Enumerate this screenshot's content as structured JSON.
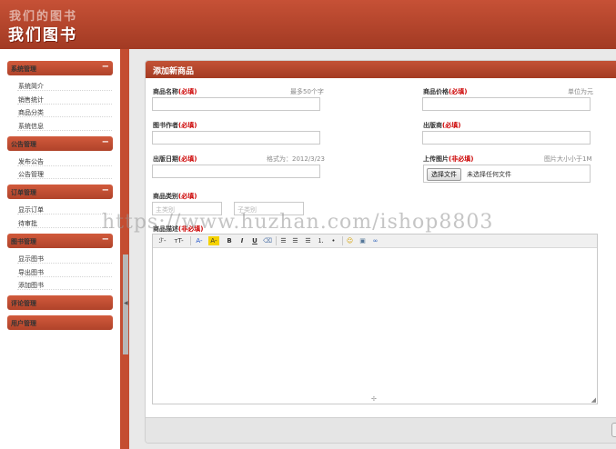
{
  "header": {
    "logo_text_top": "我们的图书",
    "logo_text": "我们图书"
  },
  "sidebar": {
    "groups": [
      {
        "title": "系统管理",
        "toggle": "−",
        "items": [
          "系统简介",
          "销售统计",
          "商品分类",
          "系统信息"
        ]
      },
      {
        "title": "公告管理",
        "toggle": "−",
        "items": [
          "发布公告",
          "公告管理"
        ]
      },
      {
        "title": "订单管理",
        "toggle": "−",
        "items": [
          "显示订单",
          "待审批"
        ]
      },
      {
        "title": "图书管理",
        "toggle": "−",
        "items": [
          "显示图书",
          "导出图书",
          "添加图书"
        ]
      },
      {
        "title": "评论管理"
      },
      {
        "title": "用户管理"
      }
    ]
  },
  "panel": {
    "title": "添加新商品",
    "fields": {
      "name": {
        "label": "商品名称",
        "req": "(必填)",
        "hint": "最多50个字",
        "value": ""
      },
      "price": {
        "label": "商品价格",
        "req": "(必填)",
        "hint": "单位为元",
        "value": ""
      },
      "author": {
        "label": "图书作者",
        "req": "(必填)",
        "value": ""
      },
      "publisher": {
        "label": "出版商",
        "req": "(必填)",
        "value": ""
      },
      "pubdate": {
        "label": "出版日期",
        "req": "(必填)",
        "hint": "格式为：2012/3/23",
        "value": ""
      },
      "image": {
        "label": "上传图片",
        "req": "(非必填)",
        "hint": "图片大小小于1M",
        "button": "选择文件",
        "filename": "未选择任何文件"
      },
      "category": {
        "label": "商品类别",
        "req": "(必填)",
        "main_placeholder": "主类别",
        "sub_placeholder": "子类别"
      },
      "desc": {
        "label": "商品描述",
        "req": "(非必填)"
      }
    },
    "toolbar": {
      "font_family": "ℱ-",
      "font_size": "ᴛT-",
      "font_color": "A-",
      "bg_color": "A-",
      "bold": "B",
      "italic": "I",
      "underline": "U",
      "eraser": "⌫",
      "align_left": "☰",
      "align_center": "☰",
      "align_right": "☰",
      "ordered_list": "⒈",
      "unordered_list": "•",
      "emoticon": "☺",
      "image": "▣",
      "link": "∞"
    }
  },
  "watermark": "https://www.huzhan.com/ishop8803"
}
